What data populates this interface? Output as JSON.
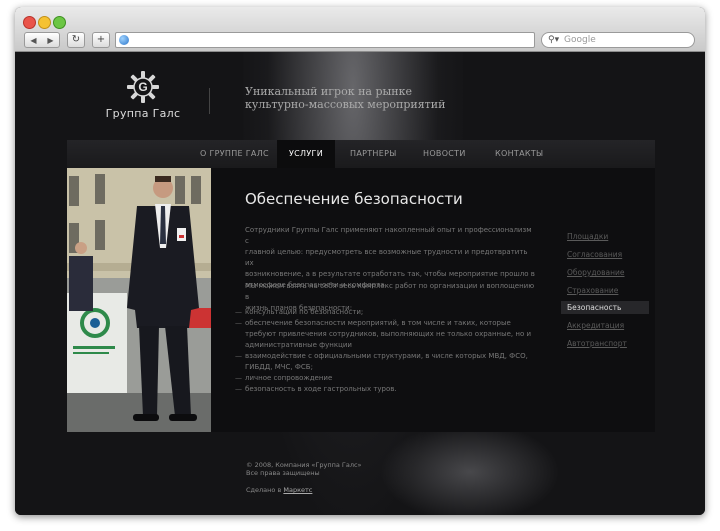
{
  "browser": {
    "back_glyph": "◀",
    "forward_glyph": "▶",
    "reload_glyph": "↻",
    "add_glyph": "+",
    "search_placeholder": "Google"
  },
  "site": {
    "logo_letter": "G",
    "logo_name": "Группа Галс",
    "tagline_line1": "Уникальный игрок на рынке",
    "tagline_line2": "культурно-массовых мероприятий"
  },
  "menu": [
    {
      "label": "О ГРУППЕ ГАЛС",
      "active": false
    },
    {
      "label": "УСЛУГИ",
      "active": true
    },
    {
      "label": "ПАРТНЕРЫ",
      "active": false
    },
    {
      "label": "НОВОСТИ",
      "active": false
    },
    {
      "label": "КОНТАКТЫ",
      "active": false
    }
  ],
  "page": {
    "title": "Обеспечение безопасности",
    "para1": [
      "Сотрудники Группы Галс применяют накопленный опыт и профессионализм с",
      "главной целью: предусмотреть все возможные трудности и предотвратить их",
      "возникновение, а в результате отработать так, чтобы мероприятие прошло в",
      "атмосфере безопасности и комфорта."
    ],
    "para2": [
      "Мы можем взять на себя весь комплекс работ по организации и воплощению в",
      "жизнь планов безопасности:"
    ],
    "bullets": [
      [
        "консультации по безопасности;"
      ],
      [
        "обеспечение безопасности мероприятий, в том числе и таких, которые",
        "требуют привлечения сотрудников, выполняющих не только охранные, но и",
        "административные функции"
      ],
      [
        "взаимодействие с официальными структурами, в числе которых МВД, ФСО,",
        "ГИБДД, МЧС, ФСБ;"
      ],
      [
        "личное сопровождение"
      ],
      [
        "безопасность в ходе гастрольных туров."
      ]
    ]
  },
  "sidebar": [
    {
      "label": "Площадки",
      "active": false
    },
    {
      "label": "Согласования",
      "active": false
    },
    {
      "label": "Оборудование",
      "active": false
    },
    {
      "label": "Страхование",
      "active": false
    },
    {
      "label": "Безопасность",
      "active": true
    },
    {
      "label": "Аккредитация",
      "active": false
    },
    {
      "label": "Автотранспорт",
      "active": false
    }
  ],
  "footer": {
    "copyright": "© 2008, Компания «Группа Галс»",
    "rights": "Все права защищены",
    "made_prefix": "Сделано в",
    "made_link": "Маркетс"
  }
}
